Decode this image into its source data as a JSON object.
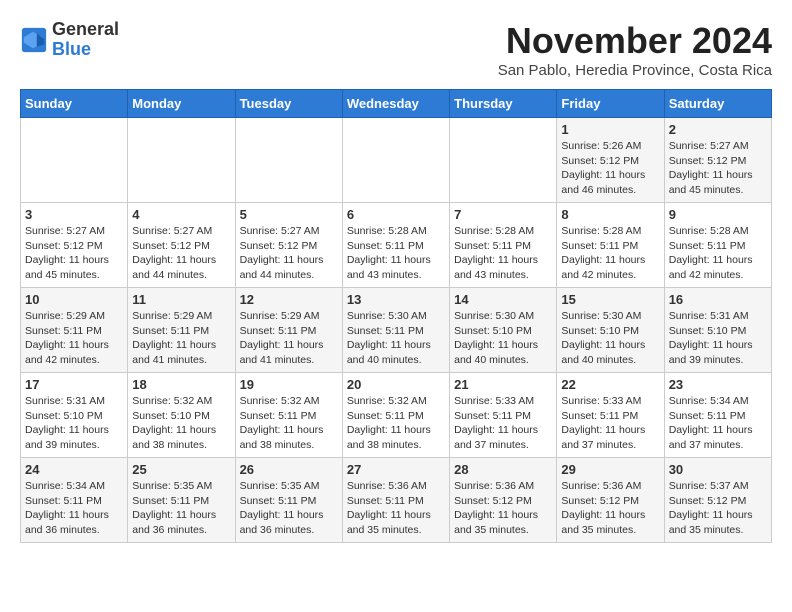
{
  "logo": {
    "line1": "General",
    "line2": "Blue"
  },
  "title": "November 2024",
  "subtitle": "San Pablo, Heredia Province, Costa Rica",
  "weekdays": [
    "Sunday",
    "Monday",
    "Tuesday",
    "Wednesday",
    "Thursday",
    "Friday",
    "Saturday"
  ],
  "weeks": [
    [
      {
        "day": "",
        "info": ""
      },
      {
        "day": "",
        "info": ""
      },
      {
        "day": "",
        "info": ""
      },
      {
        "day": "",
        "info": ""
      },
      {
        "day": "",
        "info": ""
      },
      {
        "day": "1",
        "info": "Sunrise: 5:26 AM\nSunset: 5:12 PM\nDaylight: 11 hours\nand 46 minutes."
      },
      {
        "day": "2",
        "info": "Sunrise: 5:27 AM\nSunset: 5:12 PM\nDaylight: 11 hours\nand 45 minutes."
      }
    ],
    [
      {
        "day": "3",
        "info": "Sunrise: 5:27 AM\nSunset: 5:12 PM\nDaylight: 11 hours\nand 45 minutes."
      },
      {
        "day": "4",
        "info": "Sunrise: 5:27 AM\nSunset: 5:12 PM\nDaylight: 11 hours\nand 44 minutes."
      },
      {
        "day": "5",
        "info": "Sunrise: 5:27 AM\nSunset: 5:12 PM\nDaylight: 11 hours\nand 44 minutes."
      },
      {
        "day": "6",
        "info": "Sunrise: 5:28 AM\nSunset: 5:11 PM\nDaylight: 11 hours\nand 43 minutes."
      },
      {
        "day": "7",
        "info": "Sunrise: 5:28 AM\nSunset: 5:11 PM\nDaylight: 11 hours\nand 43 minutes."
      },
      {
        "day": "8",
        "info": "Sunrise: 5:28 AM\nSunset: 5:11 PM\nDaylight: 11 hours\nand 42 minutes."
      },
      {
        "day": "9",
        "info": "Sunrise: 5:28 AM\nSunset: 5:11 PM\nDaylight: 11 hours\nand 42 minutes."
      }
    ],
    [
      {
        "day": "10",
        "info": "Sunrise: 5:29 AM\nSunset: 5:11 PM\nDaylight: 11 hours\nand 42 minutes."
      },
      {
        "day": "11",
        "info": "Sunrise: 5:29 AM\nSunset: 5:11 PM\nDaylight: 11 hours\nand 41 minutes."
      },
      {
        "day": "12",
        "info": "Sunrise: 5:29 AM\nSunset: 5:11 PM\nDaylight: 11 hours\nand 41 minutes."
      },
      {
        "day": "13",
        "info": "Sunrise: 5:30 AM\nSunset: 5:11 PM\nDaylight: 11 hours\nand 40 minutes."
      },
      {
        "day": "14",
        "info": "Sunrise: 5:30 AM\nSunset: 5:10 PM\nDaylight: 11 hours\nand 40 minutes."
      },
      {
        "day": "15",
        "info": "Sunrise: 5:30 AM\nSunset: 5:10 PM\nDaylight: 11 hours\nand 40 minutes."
      },
      {
        "day": "16",
        "info": "Sunrise: 5:31 AM\nSunset: 5:10 PM\nDaylight: 11 hours\nand 39 minutes."
      }
    ],
    [
      {
        "day": "17",
        "info": "Sunrise: 5:31 AM\nSunset: 5:10 PM\nDaylight: 11 hours\nand 39 minutes."
      },
      {
        "day": "18",
        "info": "Sunrise: 5:32 AM\nSunset: 5:10 PM\nDaylight: 11 hours\nand 38 minutes."
      },
      {
        "day": "19",
        "info": "Sunrise: 5:32 AM\nSunset: 5:11 PM\nDaylight: 11 hours\nand 38 minutes."
      },
      {
        "day": "20",
        "info": "Sunrise: 5:32 AM\nSunset: 5:11 PM\nDaylight: 11 hours\nand 38 minutes."
      },
      {
        "day": "21",
        "info": "Sunrise: 5:33 AM\nSunset: 5:11 PM\nDaylight: 11 hours\nand 37 minutes."
      },
      {
        "day": "22",
        "info": "Sunrise: 5:33 AM\nSunset: 5:11 PM\nDaylight: 11 hours\nand 37 minutes."
      },
      {
        "day": "23",
        "info": "Sunrise: 5:34 AM\nSunset: 5:11 PM\nDaylight: 11 hours\nand 37 minutes."
      }
    ],
    [
      {
        "day": "24",
        "info": "Sunrise: 5:34 AM\nSunset: 5:11 PM\nDaylight: 11 hours\nand 36 minutes."
      },
      {
        "day": "25",
        "info": "Sunrise: 5:35 AM\nSunset: 5:11 PM\nDaylight: 11 hours\nand 36 minutes."
      },
      {
        "day": "26",
        "info": "Sunrise: 5:35 AM\nSunset: 5:11 PM\nDaylight: 11 hours\nand 36 minutes."
      },
      {
        "day": "27",
        "info": "Sunrise: 5:36 AM\nSunset: 5:11 PM\nDaylight: 11 hours\nand 35 minutes."
      },
      {
        "day": "28",
        "info": "Sunrise: 5:36 AM\nSunset: 5:12 PM\nDaylight: 11 hours\nand 35 minutes."
      },
      {
        "day": "29",
        "info": "Sunrise: 5:36 AM\nSunset: 5:12 PM\nDaylight: 11 hours\nand 35 minutes."
      },
      {
        "day": "30",
        "info": "Sunrise: 5:37 AM\nSunset: 5:12 PM\nDaylight: 11 hours\nand 35 minutes."
      }
    ]
  ]
}
